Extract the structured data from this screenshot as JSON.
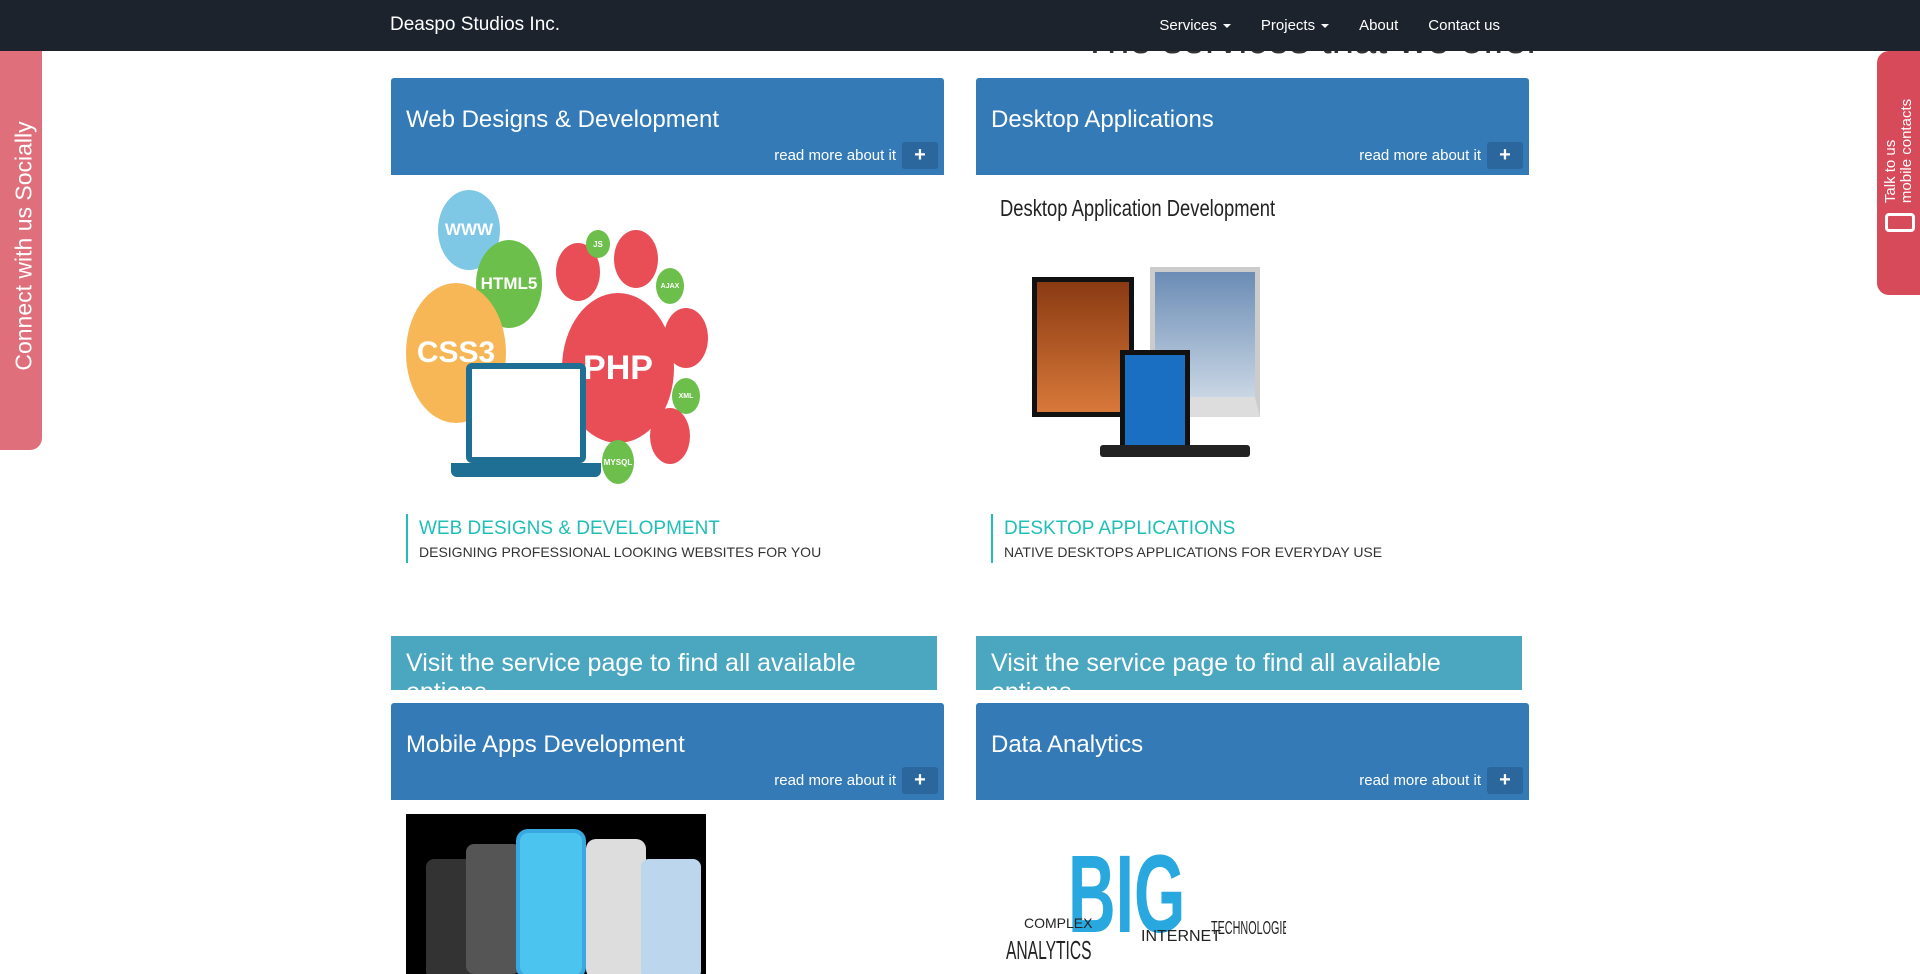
{
  "navbar": {
    "brand": "Deaspo Studios Inc.",
    "items": [
      {
        "label": "Services",
        "dropdown": true
      },
      {
        "label": "Projects",
        "dropdown": true
      },
      {
        "label": "About"
      },
      {
        "label": "Contact us"
      }
    ]
  },
  "heading": "The services that we offer",
  "side_left": {
    "label": "Connect with us Socially"
  },
  "side_right": {
    "line1": "Talk to us",
    "line2": "mobile contacts",
    "icon": "mobile-phone-icon"
  },
  "colors": {
    "navbar": "#1c232d",
    "card": "#337ab7",
    "visit": "#4ba6c0",
    "accent": "#1fbfb8",
    "social": "#e06f7c",
    "contacts": "#d64a5a"
  },
  "services": [
    {
      "title": "Web Designs & Development",
      "more": "read more about it",
      "caption_title": "Web Designs & Development",
      "caption_sub": "Designing professional looking websites for you",
      "visit": "Visit the service page to find all available options",
      "image_labels": [
        "WWW",
        "HTML5",
        "CSS3",
        "PHP",
        "JS",
        "AJAX",
        "XML",
        "MYSQL"
      ]
    },
    {
      "title": "Desktop Applications",
      "more": "read more about it",
      "caption_title": "Desktop Applications",
      "caption_sub": "Native desktops applications for everyday use",
      "visit": "Visit the service page to find all available options",
      "image_labels": [
        "Desktop Application Development"
      ]
    },
    {
      "title": "Mobile Apps Development",
      "more": "read more about it"
    },
    {
      "title": "Data Analytics",
      "more": "read more about it",
      "image_labels": [
        "BIG",
        "ANALYTICS",
        "TECHNOLOGIES",
        "INTERNET",
        "COMPLEX"
      ]
    }
  ]
}
